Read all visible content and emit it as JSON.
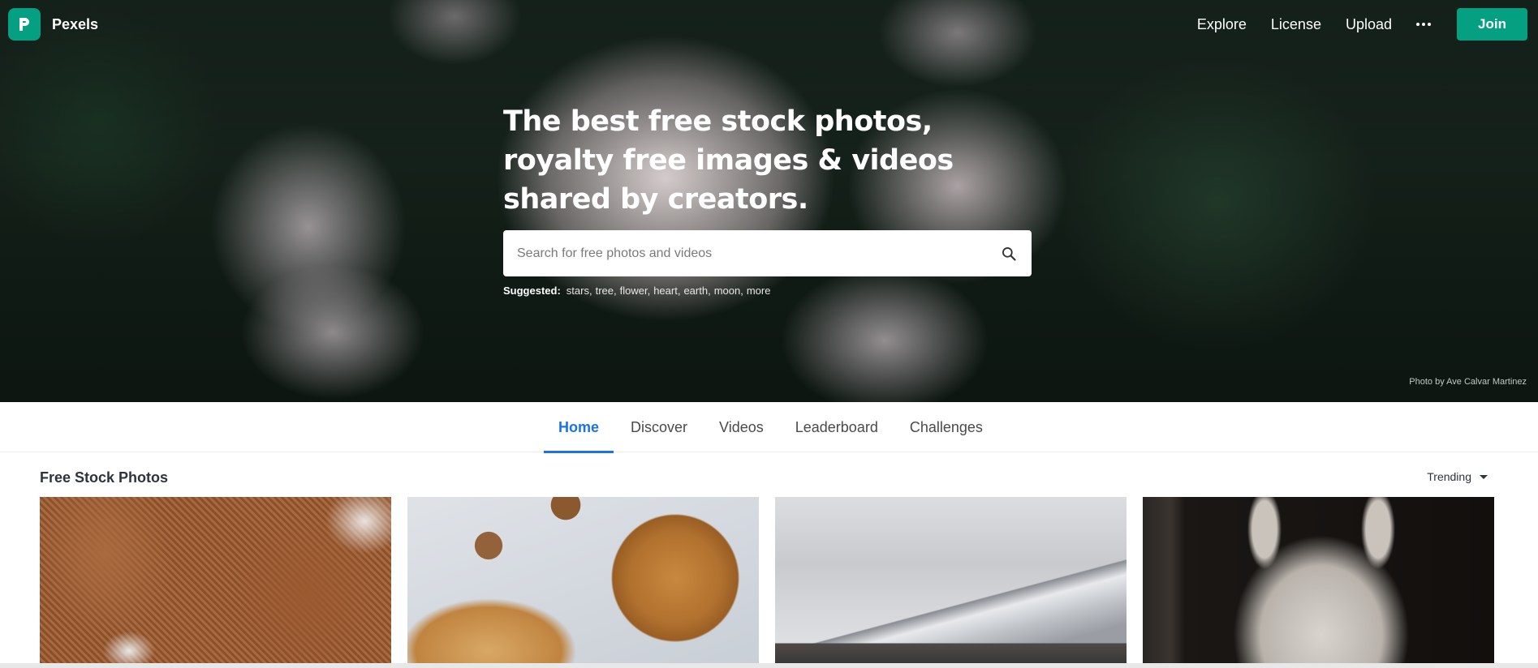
{
  "nav": {
    "brand": "Pexels",
    "links": [
      "Explore",
      "License",
      "Upload"
    ],
    "join_label": "Join"
  },
  "hero": {
    "title": "The best free stock photos, royalty free images & videos shared by creators.",
    "search_placeholder": "Search for free photos and videos",
    "suggested_label": "Suggested:",
    "suggestions": [
      "stars,",
      "tree,",
      "flower,",
      "heart,",
      "earth,",
      "moon,",
      "more"
    ],
    "photo_credit": "Photo by Ave Calvar Martinez"
  },
  "tabs": [
    "Home",
    "Discover",
    "Videos",
    "Leaderboard",
    "Challenges"
  ],
  "active_tab": "Home",
  "section": {
    "title": "Free Stock Photos",
    "sort_label": "Trending"
  },
  "colors": {
    "brand_green": "#05a081",
    "active_tab_blue": "#1a73e8"
  },
  "icons": [
    "pexels-logo-icon",
    "more-dots-icon",
    "search-icon",
    "caret-down-icon"
  ]
}
